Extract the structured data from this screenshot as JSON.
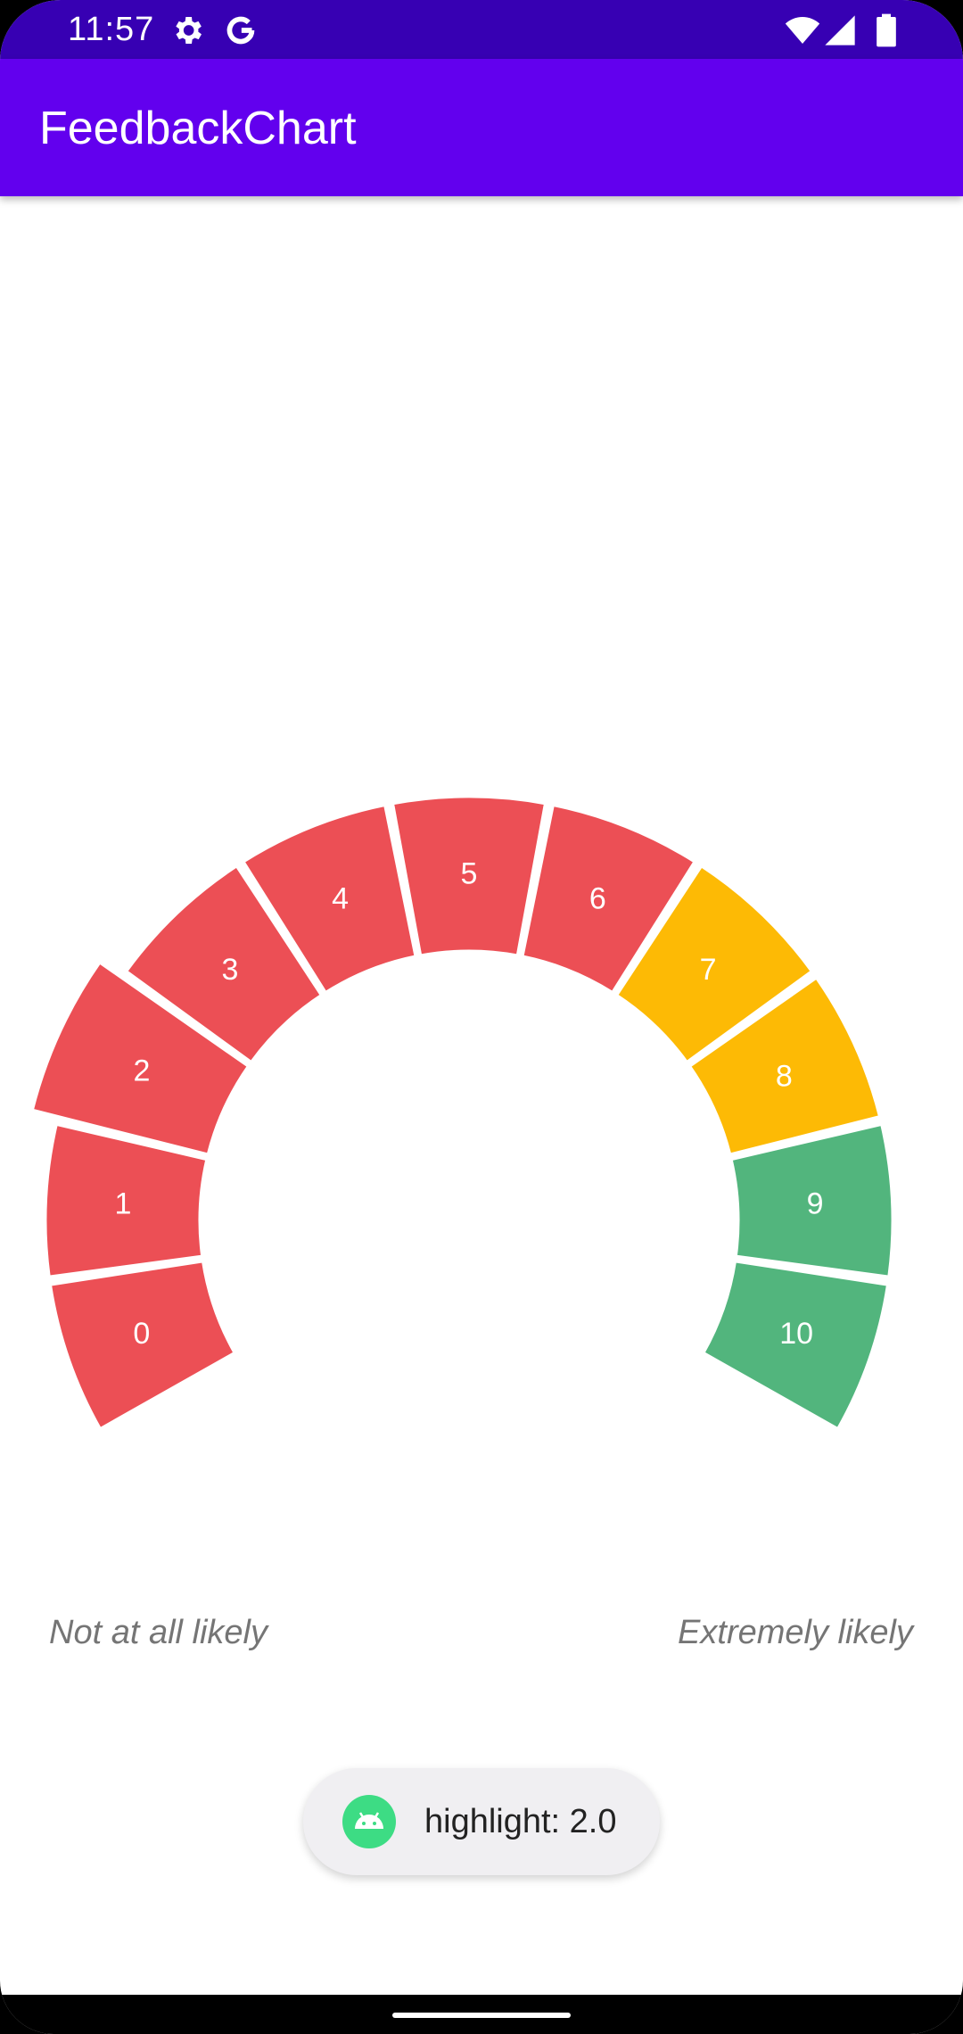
{
  "status_bar": {
    "time": "11:57",
    "icons": [
      "gear-icon",
      "google-g-icon",
      "wifi-icon",
      "signal-icon",
      "battery-icon"
    ]
  },
  "app_bar": {
    "title": "FeedbackChart"
  },
  "chart_data": {
    "type": "gauge",
    "segments": [
      {
        "label": "0",
        "value": 0,
        "color": "#EC4F55"
      },
      {
        "label": "1",
        "value": 1,
        "color": "#EC4F55"
      },
      {
        "label": "2",
        "value": 2,
        "color": "#EC4F55"
      },
      {
        "label": "3",
        "value": 3,
        "color": "#EC4F55"
      },
      {
        "label": "4",
        "value": 4,
        "color": "#EC4F55"
      },
      {
        "label": "5",
        "value": 5,
        "color": "#EC4F55"
      },
      {
        "label": "6",
        "value": 6,
        "color": "#EC4F55"
      },
      {
        "label": "7",
        "value": 7,
        "color": "#FDBA05"
      },
      {
        "label": "8",
        "value": 8,
        "color": "#FDBA05"
      },
      {
        "label": "9",
        "value": 9,
        "color": "#52B57D"
      },
      {
        "label": "10",
        "value": 10,
        "color": "#52B57D"
      }
    ],
    "highlighted_value": 2,
    "min_label": "Not at all likely",
    "max_label": "Extremely likely"
  },
  "toast": {
    "text": "highlight: 2.0",
    "icon": "android-icon"
  },
  "colors": {
    "status_bar": "#3700B3",
    "app_bar": "#6200EE",
    "detractor": "#EC4F55",
    "passive": "#FDBA05",
    "promoter": "#52B57D"
  }
}
